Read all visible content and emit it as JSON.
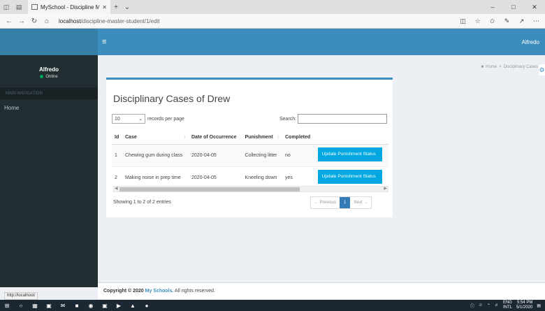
{
  "browser": {
    "tab_title": "MySchool - Discipline M",
    "url_host": "localhost",
    "url_path": "/discipline-master-student/1/edit",
    "status_url": "http://localhost/"
  },
  "header": {
    "user_name": "Alfredo"
  },
  "sidebar": {
    "user_name": "Alfredo",
    "status": "Online",
    "nav_header": "MAIN NAVIGATION",
    "items": [
      {
        "label": "Home"
      }
    ]
  },
  "breadcrumb": {
    "home": "Home",
    "separator": ">",
    "current": "Disciplinary Cases"
  },
  "box": {
    "title": "Disciplinary Cases of Drew"
  },
  "table_controls": {
    "length_value": "10",
    "length_suffix": "records per page",
    "search_label": "Search:",
    "search_value": ""
  },
  "table": {
    "columns": [
      "Id",
      "Case",
      "Date of Occurrence",
      "Punishment",
      "Completed"
    ],
    "rows": [
      {
        "id": "1",
        "case": "Chewing gum during class",
        "date": "2020-04-05",
        "punishment": "Collecting litter",
        "completed": "no",
        "action": "Update Punishment Status"
      },
      {
        "id": "2",
        "case": "Making noise in prep time",
        "date": "2020-04-05",
        "punishment": "Kneeling down",
        "completed": "yes",
        "action": "Update Punishment Status"
      }
    ]
  },
  "pagination": {
    "info": "Showing 1 to 2 of 2 entries",
    "previous": "← Previous",
    "current_page": "1",
    "next": "Next →"
  },
  "footer": {
    "prefix": "Copyright © 2020",
    "brand": "My Schools.",
    "suffix": "All rights reserved."
  },
  "taskbar": {
    "lang_top": "ENG",
    "lang_bottom": "INTL",
    "time": "5:54 PM",
    "date": "5/1/2020"
  },
  "colors": {
    "header": "#3c8dbc",
    "sidebar": "#222d32",
    "action_button": "#00a7e1",
    "pager_active": "#337ab7"
  }
}
